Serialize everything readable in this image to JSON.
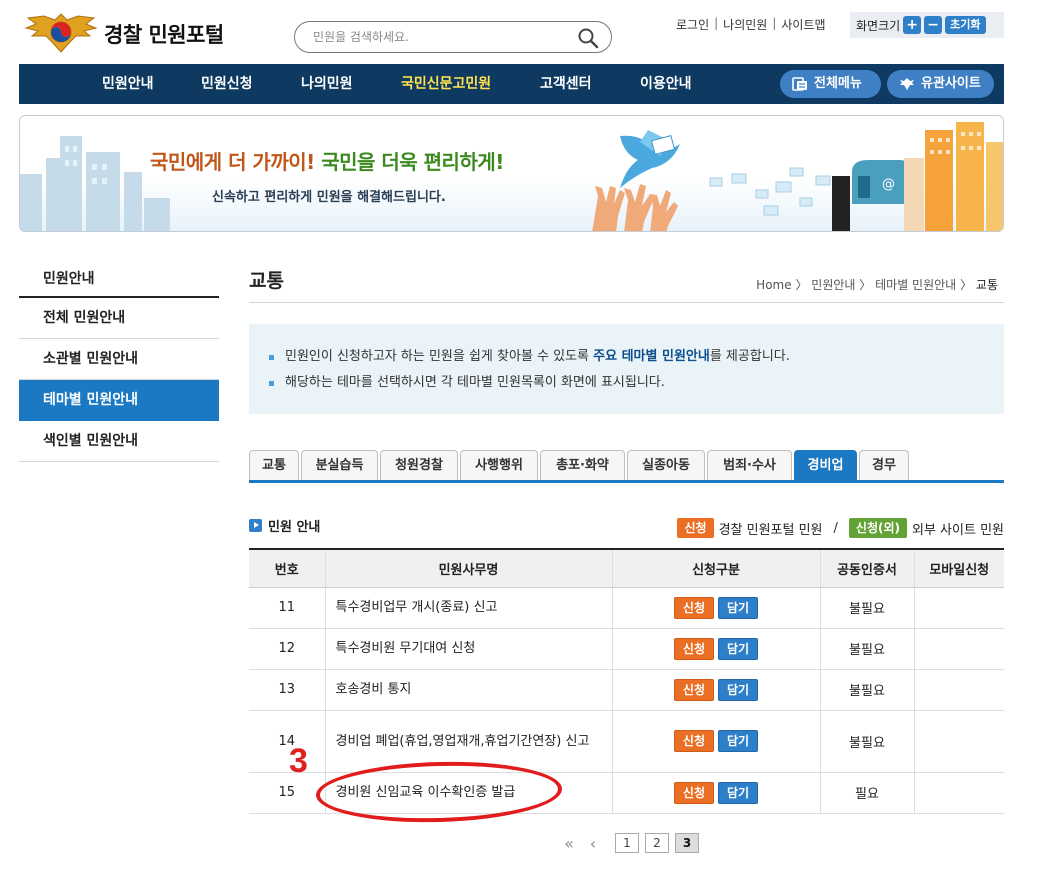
{
  "header": {
    "logo_text": "경찰 민원포털",
    "search_placeholder": "민원을 검색하세요.",
    "util_links": [
      "로그인",
      "나의민원",
      "사이트맵"
    ],
    "font_size_label": "화면크기",
    "font_plus": "+",
    "font_minus": "−",
    "font_reset": "초기화"
  },
  "gnb": {
    "items": [
      "민원안내",
      "민원신청",
      "나의민원",
      "국민신문고민원",
      "고객센터",
      "이용안내"
    ],
    "active_index": 3,
    "all_menu": "전체메뉴",
    "related_sites": "유관사이트"
  },
  "banner": {
    "headline_part1": "국민에게 더 가까이!",
    "headline_part2": "국민을 더욱 편리하게!",
    "subtitle": "신속하고 편리하게 민원을 해결해드립니다."
  },
  "sidebar": {
    "title": "민원안내",
    "items": [
      "전체 민원안내",
      "소관별 민원안내",
      "테마별 민원안내",
      "색인별 민원안내"
    ],
    "active_index": 2
  },
  "content": {
    "page_title": "교통",
    "breadcrumb": [
      "Home",
      "민원안내",
      "테마별 민원안내",
      "교통"
    ],
    "info_line1_pre": "민원인이 신청하고자 하는 민원을 쉽게 찾아볼 수 있도록 ",
    "info_line1_hl": "주요 테마별 민원안내",
    "info_line1_post": "를 제공합니다.",
    "info_line2": "해당하는 테마를 선택하시면 각 테마별 민원목록이 화면에 표시됩니다.",
    "tabs": [
      "교통",
      "분실습득",
      "청원경찰",
      "사행행위",
      "총포·화약",
      "실종아동",
      "범죄·수사",
      "경비업",
      "경무"
    ],
    "active_tab": 7,
    "section_title": "민원 안내",
    "legend_internal_badge": "신청",
    "legend_internal_text": "경찰 민원포털 민원",
    "legend_slash": "/",
    "legend_external_badge": "신청(외)",
    "legend_external_text": "외부 사이트 민원"
  },
  "table": {
    "headers": [
      "번호",
      "민원사무명",
      "신청구분",
      "공동인증서",
      "모바일신청"
    ],
    "apply_label": "신청",
    "save_label": "담기",
    "rows": [
      {
        "no": "11",
        "name": "특수경비업무 개시(종료) 신고",
        "cert": "불필요",
        "mobile": ""
      },
      {
        "no": "12",
        "name": "특수경비원 무기대여 신청",
        "cert": "불필요",
        "mobile": ""
      },
      {
        "no": "13",
        "name": "호송경비 통지",
        "cert": "불필요",
        "mobile": ""
      },
      {
        "no": "14",
        "name": "경비업 폐업(휴업,영업재개,휴업기간연장) 신고",
        "cert": "불필요",
        "mobile": ""
      },
      {
        "no": "15",
        "name": "경비원 신임교육 이수확인증 발급",
        "cert": "필요",
        "mobile": ""
      }
    ]
  },
  "pagination": {
    "first": "«",
    "prev": "‹",
    "pages": [
      "1",
      "2",
      "3"
    ],
    "current": "3"
  },
  "annotation": {
    "number": "3",
    "color": "#e02020"
  },
  "colors": {
    "nav_bg": "#0e3a62",
    "accent_blue": "#1b78c2",
    "apply_orange": "#ea6e24",
    "external_green": "#63a235"
  }
}
